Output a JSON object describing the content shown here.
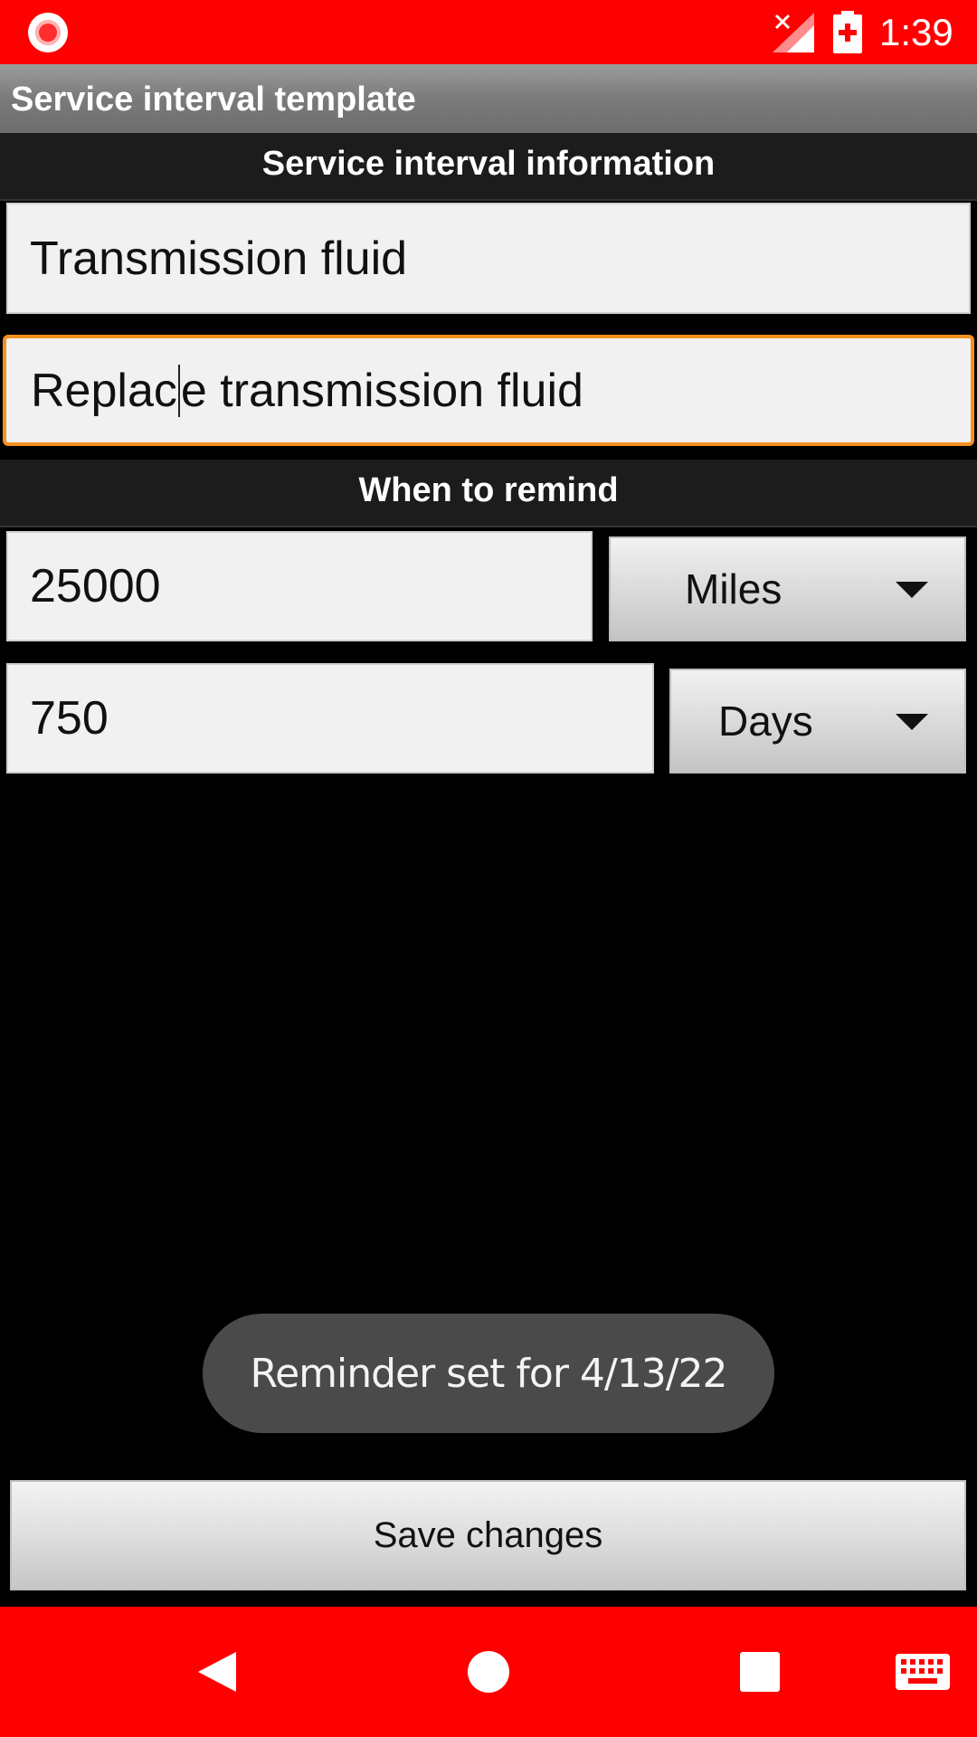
{
  "status_bar": {
    "time": "1:39",
    "icons": [
      "record-icon",
      "signal-no-service-icon",
      "battery-charging-icon"
    ],
    "color": "#ff0000"
  },
  "app": {
    "title": "Service interval template"
  },
  "sections": {
    "info_header": "Service interval information",
    "remind_header": "When to remind"
  },
  "form": {
    "name_value": "Transmission fluid",
    "description_before_cursor": "Replac",
    "description_after_cursor": "e transmission fluid",
    "miles_value": "25000",
    "miles_unit": "Miles",
    "days_value": "750",
    "days_unit": "Days",
    "focus_color": "#f5901e"
  },
  "toast": {
    "message": "Reminder set for 4/13/22"
  },
  "actions": {
    "save_label": "Save changes"
  },
  "nav_bar": {
    "icons": [
      "back-icon",
      "home-icon",
      "recent-apps-icon",
      "keyboard-icon"
    ],
    "color": "#ff0000"
  }
}
